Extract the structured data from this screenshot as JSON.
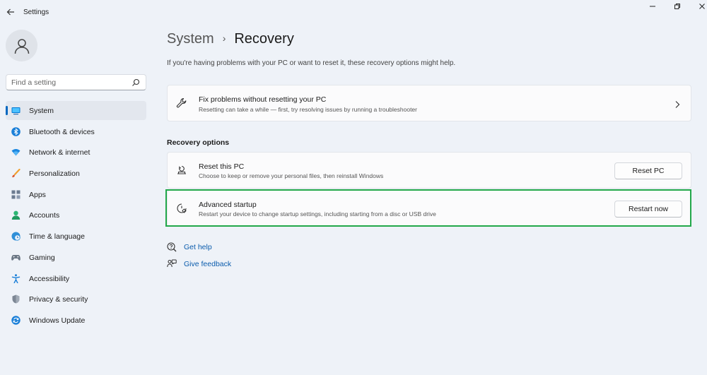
{
  "window": {
    "title": "Settings"
  },
  "search": {
    "placeholder": "Find a setting"
  },
  "sidebar": {
    "items": [
      {
        "label": "System",
        "icon": "monitor-icon",
        "active": true
      },
      {
        "label": "Bluetooth & devices",
        "icon": "bluetooth-icon"
      },
      {
        "label": "Network & internet",
        "icon": "wifi-icon"
      },
      {
        "label": "Personalization",
        "icon": "brush-icon"
      },
      {
        "label": "Apps",
        "icon": "apps-icon"
      },
      {
        "label": "Accounts",
        "icon": "person-icon"
      },
      {
        "label": "Time & language",
        "icon": "globe-clock-icon"
      },
      {
        "label": "Gaming",
        "icon": "gamepad-icon"
      },
      {
        "label": "Accessibility",
        "icon": "accessibility-icon"
      },
      {
        "label": "Privacy & security",
        "icon": "shield-icon"
      },
      {
        "label": "Windows Update",
        "icon": "update-icon"
      }
    ]
  },
  "header": {
    "parent": "System",
    "current": "Recovery",
    "description": "If you're having problems with your PC or want to reset it, these recovery options might help."
  },
  "fix_card": {
    "title": "Fix problems without resetting your PC",
    "subtitle": "Resetting can take a while — first, try resolving issues by running a troubleshooter",
    "icon": "wrench-icon"
  },
  "recovery": {
    "section_label": "Recovery options",
    "reset": {
      "title": "Reset this PC",
      "subtitle": "Choose to keep or remove your personal files, then reinstall Windows",
      "button": "Reset PC",
      "icon": "reset-pc-icon"
    },
    "advanced": {
      "title": "Advanced startup",
      "subtitle": "Restart your device to change startup settings, including starting from a disc or USB drive",
      "button": "Restart now",
      "icon": "advanced-startup-icon"
    }
  },
  "links": {
    "help": "Get help",
    "feedback": "Give feedback"
  },
  "colors": {
    "accent": "#0067c0",
    "link": "#0b5cad",
    "highlight": "#22a84a"
  }
}
